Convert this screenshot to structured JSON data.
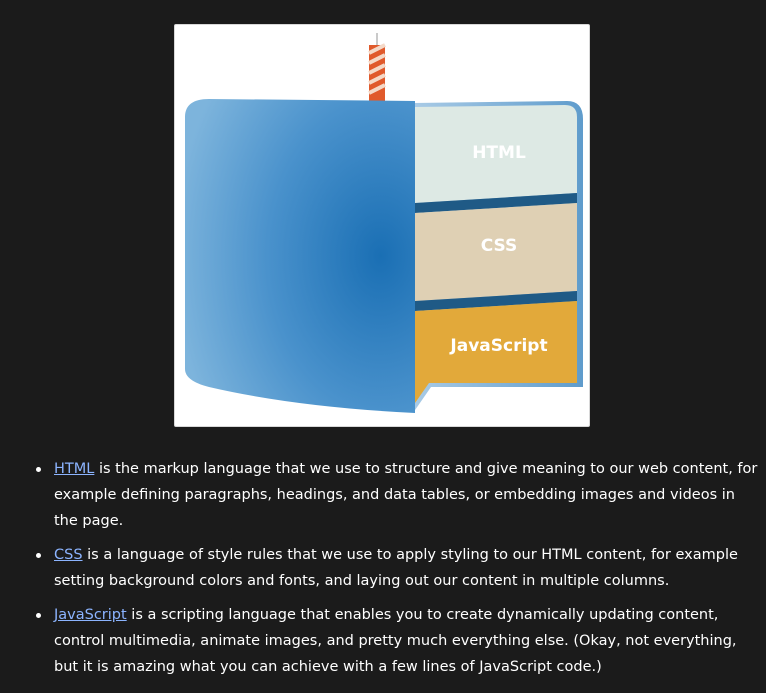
{
  "diagram": {
    "layers": [
      {
        "label": "HTML",
        "color": "#dde9e4"
      },
      {
        "label": "CSS",
        "color": "#dfd0b4"
      },
      {
        "label": "JavaScript",
        "color": "#e2a93a"
      }
    ],
    "cake_color": "#2e7ec0",
    "stripe_color": "#1f5a86"
  },
  "list": {
    "items": [
      {
        "link": "HTML",
        "text": " is the markup language that we use to structure and give meaning to our web content, for example defining paragraphs, headings, and data tables, or embedding images and videos in the page."
      },
      {
        "link": "CSS",
        "text": " is a language of style rules that we use to apply styling to our HTML content, for example setting background colors and fonts, and laying out our content in multiple columns."
      },
      {
        "link": "JavaScript",
        "text": " is a scripting language that enables you to create dynamically updating content, control multimedia, animate images, and pretty much everything else. (Okay, not everything, but it is amazing what you can achieve with a few lines of JavaScript code.)"
      }
    ]
  }
}
